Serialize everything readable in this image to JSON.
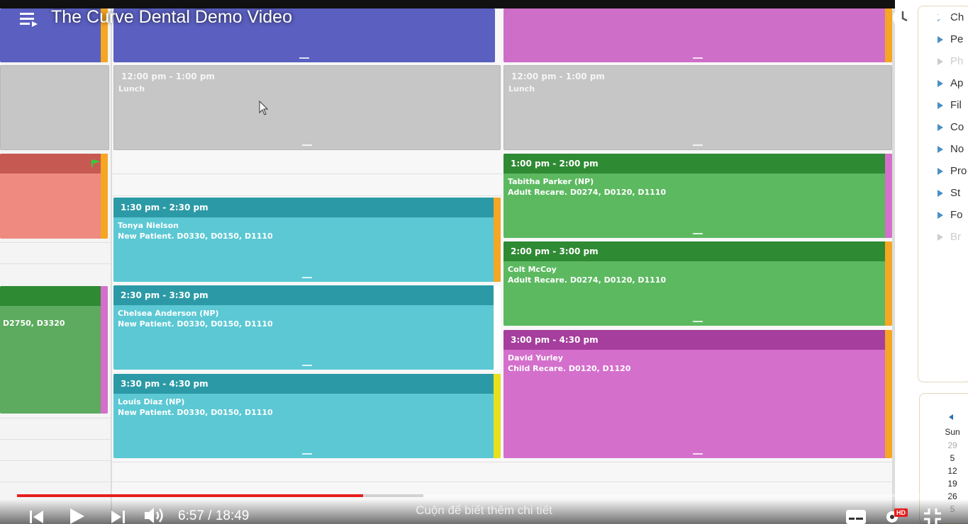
{
  "video": {
    "title": "The Curve Dental Demo Video",
    "current_time": "6:57",
    "duration": "18:49",
    "time_display": "6:57 / 18:49",
    "progress_fraction": 0.37,
    "buffered_fraction": 0.435,
    "scroll_hint": "Cuộn để biết thêm chi tiết",
    "hd_badge": "HD",
    "progress_color": "#e51e1e"
  },
  "schedule": {
    "left_column": {
      "partial_codes": "D2750, D3320"
    },
    "middle_column": {
      "lunch": {
        "time": "12:00 pm - 1:00 pm",
        "label": "Lunch"
      },
      "appointments": [
        {
          "time": "1:30 pm - 2:30 pm",
          "patient": "Tonya Nielson",
          "detail": "New Patient. D0330, D0150, D1110",
          "color": "teal",
          "edge": "#f5a623"
        },
        {
          "time": "2:30 pm - 3:30 pm",
          "patient": "Chelsea Anderson (NP)",
          "detail": "New Patient. D0330, D0150, D1110",
          "color": "teal",
          "edge": "#ffffff"
        },
        {
          "time": "3:30 pm - 4:30 pm",
          "patient": "Louis Diaz (NP)",
          "detail": "New Patient. D0330, D0150, D1110",
          "color": "teal",
          "edge": "#e8e01c"
        }
      ]
    },
    "right_column": {
      "lunch": {
        "time": "12:00 pm - 1:00 pm",
        "label": "Lunch"
      },
      "appointments": [
        {
          "time": "1:00 pm - 2:00 pm",
          "patient": "Tabitha Parker (NP)",
          "detail": "Adult Recare. D0274, D0120, D1110",
          "color": "green",
          "edge": "#d46fcc"
        },
        {
          "time": "2:00 pm - 3:00 pm",
          "patient": "Colt McCoy",
          "detail": "Adult Recare. D0274, D0120, D1110",
          "color": "green",
          "edge": "#f5a623"
        },
        {
          "time": "3:00 pm - 4:30 pm",
          "patient": "David Yurley",
          "detail": "Child Recare. D0120, D1120",
          "color": "pink",
          "edge": "#f5a623"
        }
      ]
    }
  },
  "side_menu": {
    "items": [
      {
        "label": "Ch",
        "dim": false
      },
      {
        "label": "Pe",
        "dim": false
      },
      {
        "label": "Ph",
        "dim": true
      },
      {
        "label": "Ap",
        "dim": false
      },
      {
        "label": "Fil",
        "dim": false
      },
      {
        "label": "Co",
        "dim": false
      },
      {
        "label": "No",
        "dim": false
      },
      {
        "label": "Pro",
        "dim": false
      },
      {
        "label": "St",
        "dim": false
      },
      {
        "label": "Fo",
        "dim": false
      },
      {
        "label": "Br",
        "dim": true
      }
    ]
  },
  "mini_calendar": {
    "day_header": "Sun",
    "dates": [
      "29",
      "5",
      "12",
      "19",
      "26",
      "5"
    ]
  },
  "icons": {
    "playlist": "playlist-icon",
    "watch_later": "clock-icon",
    "share": "share-icon",
    "previous": "skip-previous-icon",
    "play": "play-icon",
    "next": "skip-next-icon",
    "volume": "volume-icon",
    "subtitles": "subtitles-icon",
    "settings": "gear-icon",
    "exit_fullscreen": "exit-fullscreen-icon"
  }
}
